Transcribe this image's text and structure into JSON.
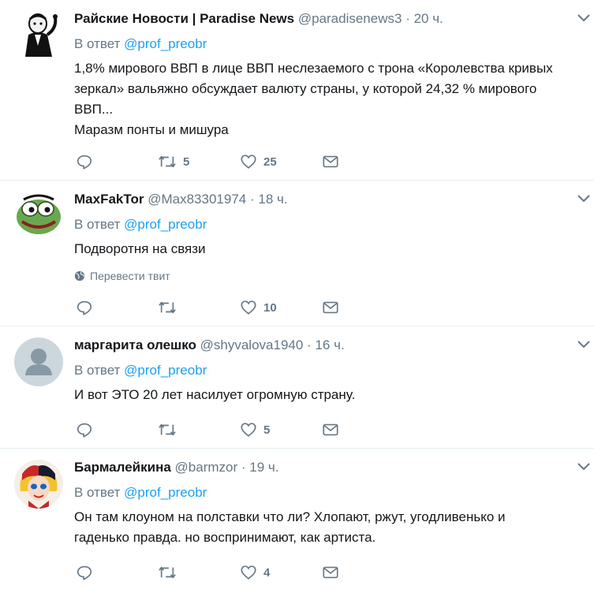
{
  "tweets": [
    {
      "name": "Райские Новости | Paradise News",
      "handle": "@paradisenews3",
      "time": "20 ч.",
      "reply_prefix": "В ответ ",
      "reply_to": "@prof_preobr",
      "lines": [
        "1,8% мирового ВВП в лице ВВП неслезаемого с трона «Королевства кривых",
        "зеркал» вальяжно обсуждает валюту страны, у которой 24,32 % мирового",
        "ВВП...",
        "Маразм понты и мишура"
      ],
      "retweets": "5",
      "likes": "25",
      "avatar": "black-and-white-cartoon-figure"
    },
    {
      "name": "MaxFakTor",
      "handle": "@Max83301974",
      "time": "18 ч.",
      "reply_prefix": "В ответ ",
      "reply_to": "@prof_preobr",
      "lines": [
        "Подворотня на связи"
      ],
      "translate": "Перевести твит",
      "retweets": "",
      "likes": "10",
      "avatar": "green-frog-cartoon"
    },
    {
      "name": "маргарита олешко",
      "handle": "@shyvalova1940",
      "time": "16 ч.",
      "reply_prefix": "В ответ ",
      "reply_to": "@prof_preobr",
      "lines": [
        "И вот ЭТО 20 лет насилует огромную страну."
      ],
      "retweets": "",
      "likes": "5",
      "avatar": "default-profile-silhouette"
    },
    {
      "name": "Бармалейкина",
      "handle": "@barmzor",
      "time": "19 ч.",
      "reply_prefix": "В ответ ",
      "reply_to": "@prof_preobr",
      "lines": [
        "Он там клоуном на полставки что ли? Хлопают, ржут, угодливенько и",
        "гаденько правда. но воспринимают, как артиста."
      ],
      "retweets": "",
      "likes": "4",
      "avatar": "cartoon-harlequin-girl"
    }
  ],
  "colors": {
    "link": "#1da1f2",
    "secondary": "#657786",
    "text": "#14171a",
    "divider": "#e6ecf0"
  }
}
